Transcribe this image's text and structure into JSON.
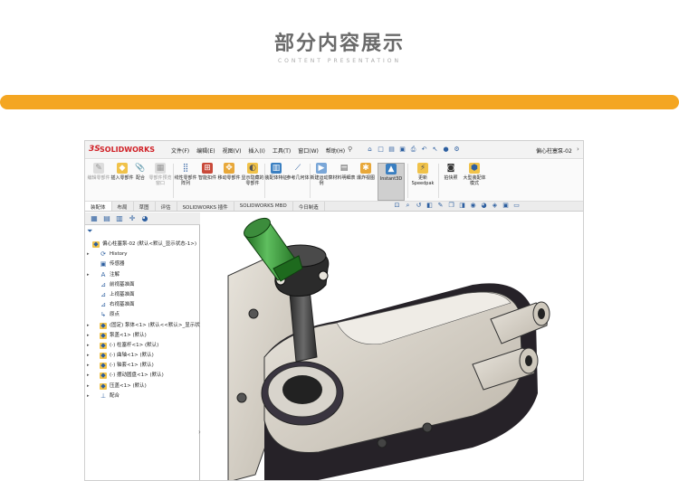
{
  "header": {
    "title": "部分内容展示",
    "subtitle": "CONTENT PRESENTATION"
  },
  "colors": {
    "accent_bar": "#f4a622",
    "logo_red": "#d01f25",
    "part_green": "#2e8a2e",
    "part_dark": "#3a3a3a",
    "part_grey": "#d8d4cc"
  },
  "app": {
    "logo_ds": "3S",
    "logo_text": "SOLIDWORKS",
    "menu": [
      "文件(F)",
      "编辑(E)",
      "视图(V)",
      "插入(I)",
      "工具(T)",
      "窗口(W)",
      "帮助(H)"
    ],
    "document_title": "偏心柱塞泵-02",
    "quick_toolbar_icons": [
      "home-icon",
      "new-icon",
      "open-icon",
      "save-icon",
      "print-icon",
      "undo-icon",
      "select-icon",
      "rebuild-icon",
      "options-icon"
    ]
  },
  "ribbon": {
    "buttons": [
      {
        "label": "编辑零部件",
        "icon": "edit-part-icon",
        "dim": true
      },
      {
        "label": "插入零部件",
        "icon": "insert-part-icon",
        "dim": false
      },
      {
        "label": "配合",
        "icon": "mate-icon",
        "dim": false
      },
      {
        "label": "零部件预览窗口",
        "icon": "preview-icon",
        "dim": true
      },
      {
        "label": "线性零部件阵列",
        "icon": "linear-pattern-icon",
        "dim": false
      },
      {
        "label": "智能扣件",
        "icon": "smart-fastener-icon",
        "dim": false
      },
      {
        "label": "移动零部件",
        "icon": "move-part-icon",
        "dim": false
      },
      {
        "label": "显示隐藏的零部件",
        "icon": "show-hidden-icon",
        "dim": false
      },
      {
        "label": "装配体特征",
        "icon": "assembly-feature-icon",
        "dim": false
      },
      {
        "label": "参考几何体",
        "icon": "reference-geometry-icon",
        "dim": false
      },
      {
        "label": "新建运动算例",
        "icon": "motion-study-icon",
        "dim": false
      },
      {
        "label": "材料明细表",
        "icon": "bom-icon",
        "dim": false
      },
      {
        "label": "爆炸视图",
        "icon": "explode-icon",
        "dim": false
      },
      {
        "label": "Instant3D",
        "icon": "instant3d-icon",
        "dim": false,
        "active": true
      },
      {
        "label": "更新Speedpak",
        "icon": "speedpak-icon",
        "dim": false
      },
      {
        "label": "拍快照",
        "icon": "snapshot-icon",
        "dim": false
      },
      {
        "label": "大型装配体模式",
        "icon": "large-assembly-icon",
        "dim": false
      }
    ]
  },
  "tabs": [
    "装配体",
    "布局",
    "草图",
    "评估",
    "SOLIDWORKS 插件",
    "SOLIDWORKS MBD",
    "今日制造"
  ],
  "view_toolbar_icons": [
    "zoom-fit-icon",
    "zoom-area-icon",
    "previous-view-icon",
    "section-view-icon",
    "dynamic-annotation-icon",
    "view-orientation-icon",
    "display-style-icon",
    "hide-show-icon",
    "edit-appearance-icon",
    "scene-icon",
    "view-settings-icon",
    "monitor-icon"
  ],
  "feature_manager": {
    "tab_icons": [
      "feature-tree-icon",
      "property-icon",
      "config-icon",
      "dimxpert-icon",
      "display-icon"
    ],
    "filter_icon": "filter-icon",
    "tree": [
      {
        "label": "偏心柱塞泵-02 (默认<默认_显示状态-1>)",
        "icon": "assembly-icon",
        "level": 0,
        "arrow": ""
      },
      {
        "label": "History",
        "icon": "history-icon",
        "level": 1,
        "arrow": "▸"
      },
      {
        "label": "传感器",
        "icon": "sensor-icon",
        "level": 1,
        "arrow": ""
      },
      {
        "label": "注解",
        "icon": "annotation-icon",
        "level": 1,
        "arrow": "▸"
      },
      {
        "label": "前视基准面",
        "icon": "plane-icon",
        "level": 1,
        "arrow": ""
      },
      {
        "label": "上视基准面",
        "icon": "plane-icon",
        "level": 1,
        "arrow": ""
      },
      {
        "label": "右视基准面",
        "icon": "plane-icon",
        "level": 1,
        "arrow": ""
      },
      {
        "label": "原点",
        "icon": "origin-icon",
        "level": 1,
        "arrow": ""
      },
      {
        "label": "(固定) 泵体<1> (默认<<默认>_显示状态",
        "icon": "part-icon",
        "level": 1,
        "arrow": "▸"
      },
      {
        "label": "泵盖<1> (默认)",
        "icon": "part-icon",
        "level": 1,
        "arrow": "▸"
      },
      {
        "label": "(-) 柱塞杆<1> (默认)",
        "icon": "part-icon",
        "level": 1,
        "arrow": "▸"
      },
      {
        "label": "(-) 曲轴<1> (默认)",
        "icon": "part-icon",
        "level": 1,
        "arrow": "▸"
      },
      {
        "label": "(-) 轴套<1> (默认)",
        "icon": "part-icon",
        "level": 1,
        "arrow": "▸"
      },
      {
        "label": "(-) 摆动圆盘<1> (默认)",
        "icon": "part-icon",
        "level": 1,
        "arrow": "▸"
      },
      {
        "label": "压盖<1> (默认)",
        "icon": "part-icon",
        "level": 1,
        "arrow": "▸"
      },
      {
        "label": "配合",
        "icon": "mates-icon",
        "level": 1,
        "arrow": "▸"
      }
    ]
  }
}
